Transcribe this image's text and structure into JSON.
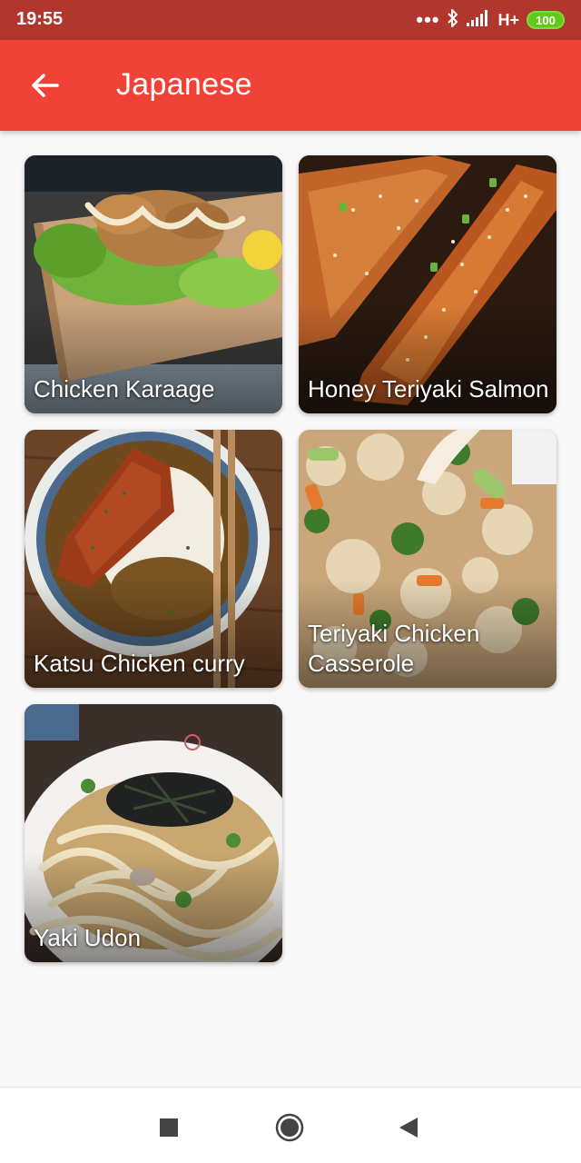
{
  "status_bar": {
    "time": "19:55",
    "network": "H+",
    "battery": "100"
  },
  "app_bar": {
    "title": "Japanese",
    "back_icon": "arrow-left-icon"
  },
  "recipes": [
    {
      "title": "Chicken Karaage"
    },
    {
      "title": "Honey Teriyaki Salmon"
    },
    {
      "title": "Katsu Chicken curry"
    },
    {
      "title": "Teriyaki Chicken Casserole"
    },
    {
      "title": "Yaki Udon"
    }
  ],
  "nav_bar": {
    "buttons": [
      "square-icon",
      "circle-home-icon",
      "triangle-back-icon"
    ]
  },
  "colors": {
    "status_bar": "#b1362d",
    "app_bar": "#f14237",
    "background": "#f8f8f8"
  }
}
